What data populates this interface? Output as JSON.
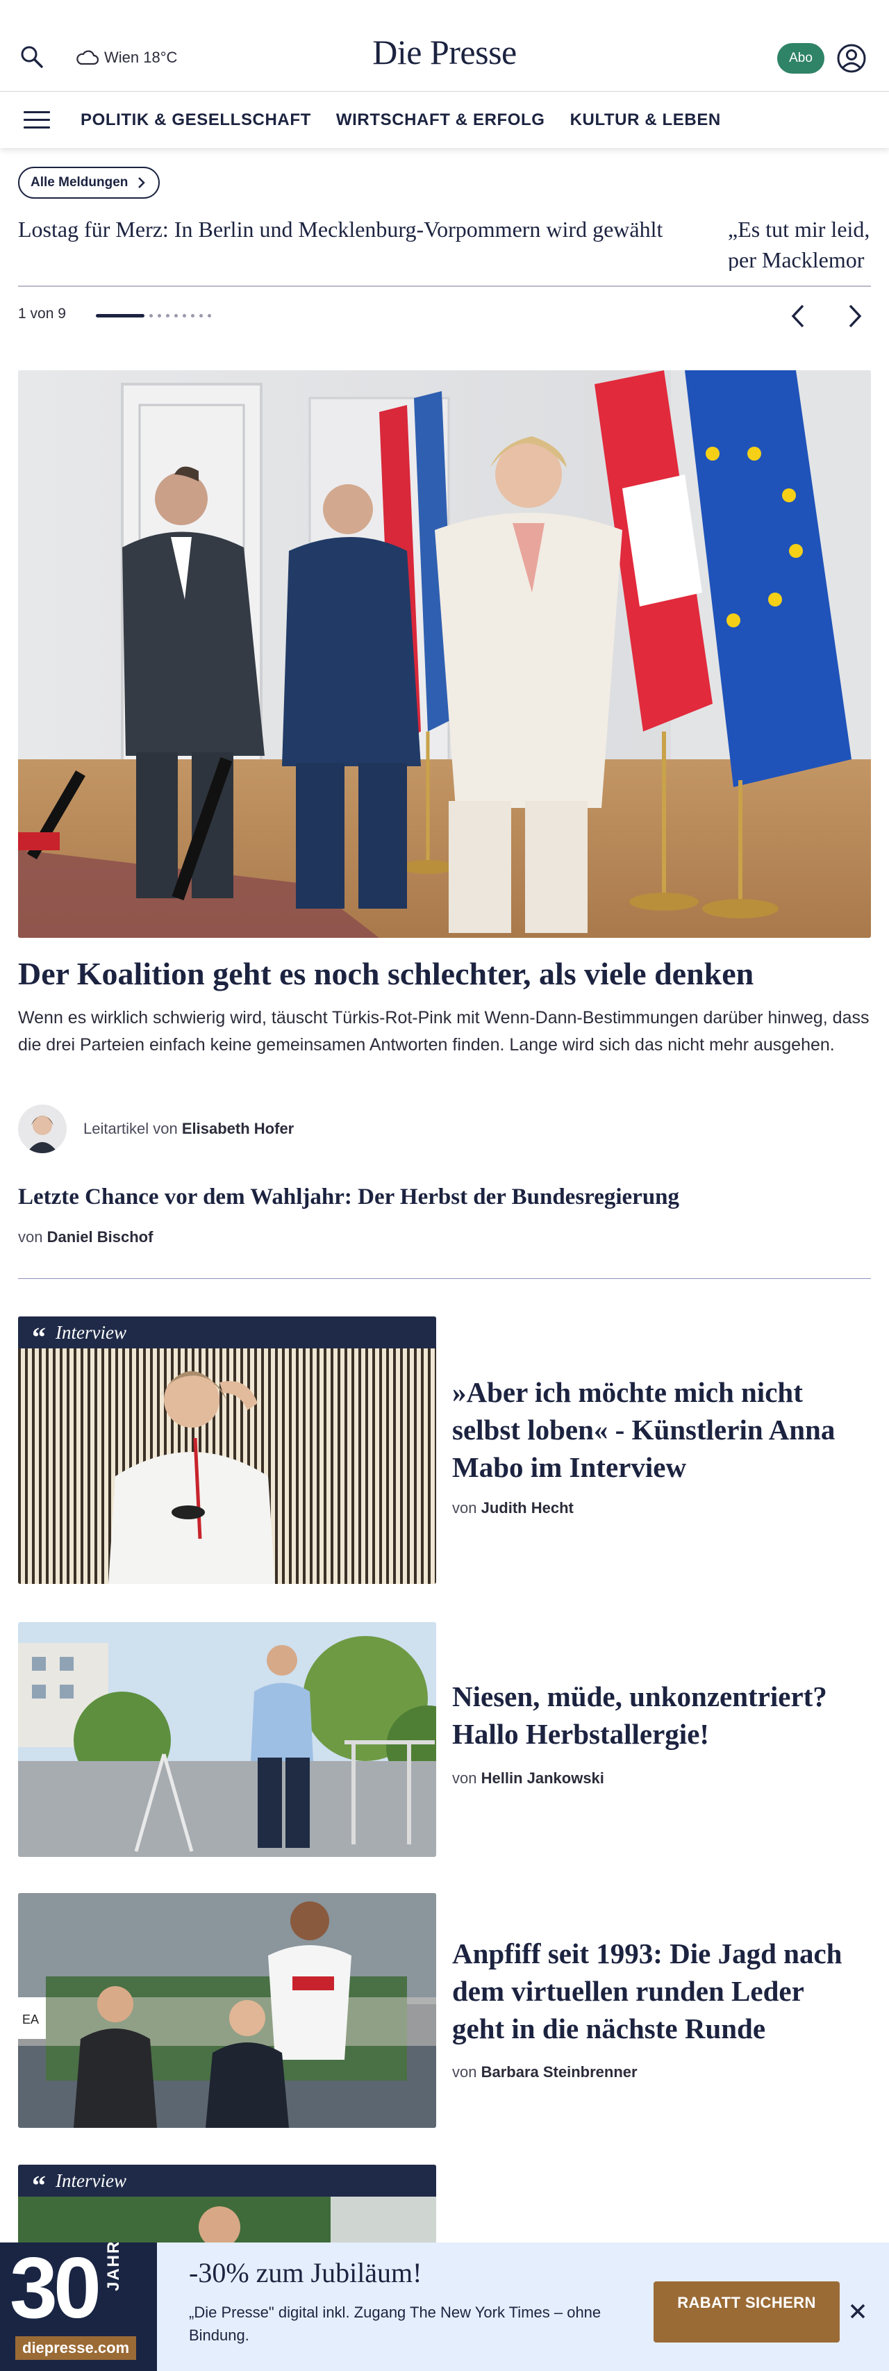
{
  "header": {
    "logo": "Die Presse",
    "weather": "Wien 18°C",
    "abo_label": "Abo"
  },
  "nav": {
    "items": [
      {
        "label": "POLITIK & GESELLSCHAFT"
      },
      {
        "label": "WIRTSCHAFT & ERFOLG"
      },
      {
        "label": "KULTUR & LEBEN"
      }
    ]
  },
  "ticker": {
    "all_label": "Alle Meldungen",
    "items": [
      {
        "text": "Lostag für Merz: In Berlin und Mecklenburg-Vorpommern wird gewählt"
      },
      {
        "text": "„Es tut mir leid, per Macklemor"
      }
    ],
    "counter": "1 von 9"
  },
  "lead": {
    "title": "Der Koalition geht es noch schlechter, als viele denken",
    "teaser": "Wenn es wirklich schwierig wird, täuscht Türkis-Rot-Pink mit Wenn-Dann-Bestimmungen darüber hinweg, dass die drei Parteien einfach keine gemeinsamen Antworten finden. Lange wird sich das nicht mehr ausgehen.",
    "byline_prefix": "Leitartikel von",
    "author": "Elisabeth Hofer"
  },
  "second": {
    "title": "Letzte Chance vor dem Wahljahr: Der Herbst der Bundesregierung",
    "byline_prefix": "von",
    "author": "Daniel Bischof"
  },
  "articles": [
    {
      "kicker": "Interview",
      "title": "»Aber ich möchte mich nicht selbst loben« - Künstlerin Anna Mabo im Interview",
      "byline_prefix": "von",
      "author": "Judith Hecht"
    },
    {
      "title": "Niesen, müde, unkonzentriert? Hallo Herbstallergie!",
      "byline_prefix": "von",
      "author": "Hellin Jankowski"
    },
    {
      "title": "Anpfiff seit 1993: Die Jagd nach dem virtuellen runden Leder geht in die nächste Runde",
      "byline_prefix": "von",
      "author": "Barbara Steinbrenner"
    },
    {
      "kicker": "Interview"
    }
  ],
  "promo": {
    "badge_number": "30",
    "badge_word": "JAHRE",
    "badge_domain": "diepresse.com",
    "title": "-30% zum Jubiläum!",
    "text": "„Die Presse\" digital inkl. Zugang The New York Times – ohne Bindung.",
    "cta": "RABATT SICHERN"
  },
  "colors": {
    "brand_navy": "#1c2340",
    "abo_green": "#2f8366",
    "cta_brown": "#9b6b36",
    "promo_bg": "#e5eefc"
  },
  "icons": [
    "search-icon",
    "cloud-icon",
    "account-icon",
    "hamburger-icon",
    "chevron-right-icon",
    "arrow-left-icon",
    "arrow-right-icon",
    "quote-icon",
    "close-icon"
  ]
}
